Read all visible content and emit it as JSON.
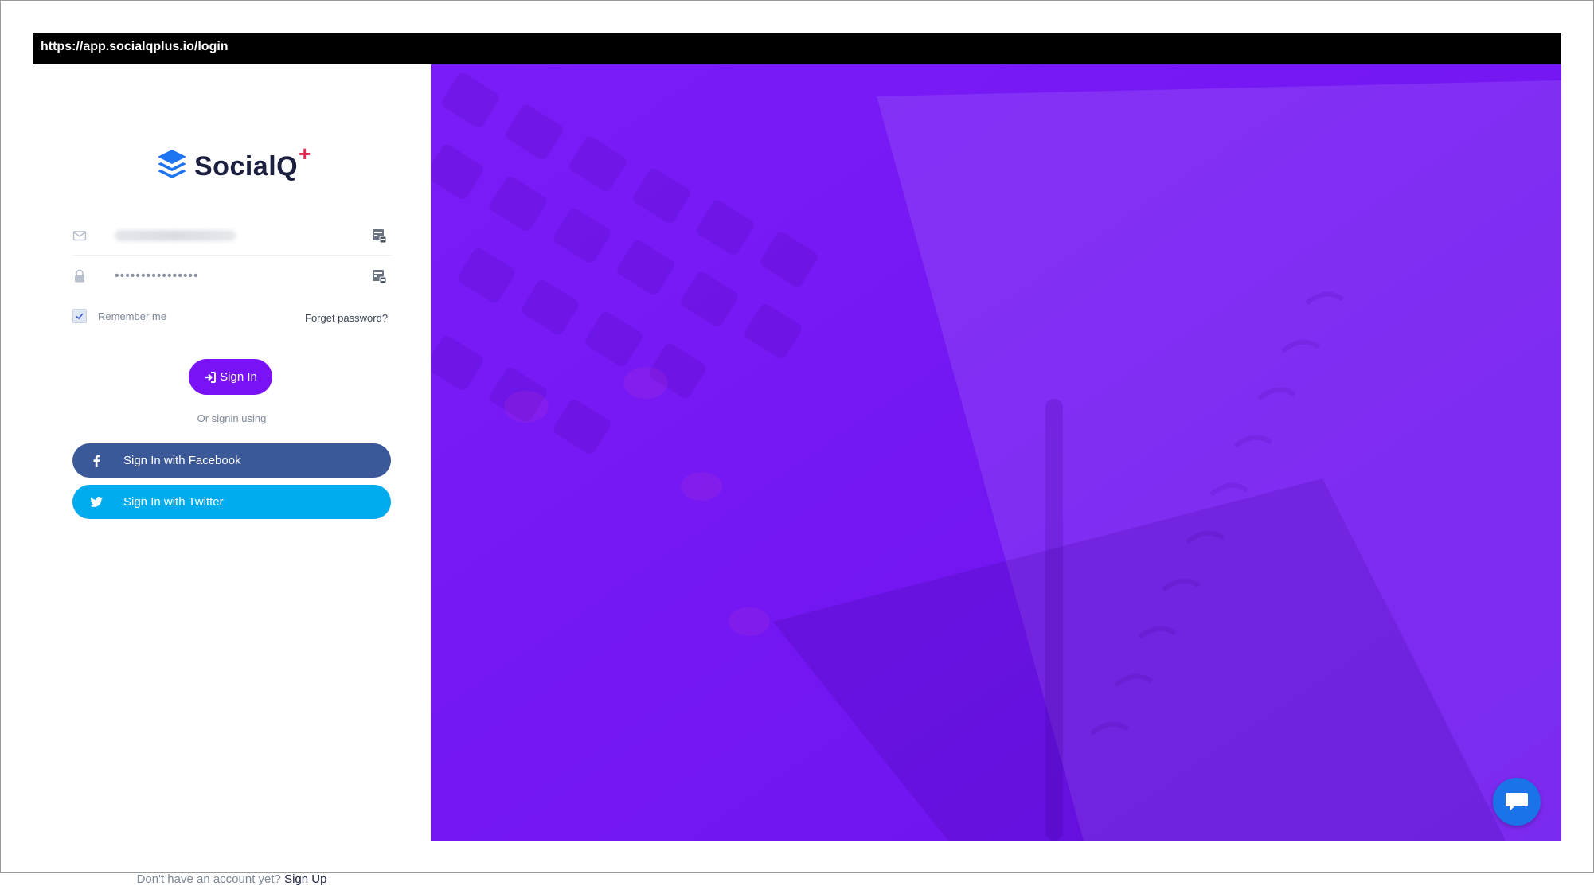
{
  "browser": {
    "url": "https://app.socialqplus.io/login"
  },
  "logo": {
    "text": "SocialQ",
    "plus": "+"
  },
  "form": {
    "email_value": "",
    "password_value": "••••••••••••••••",
    "remember_label": "Remember me",
    "remember_checked": true,
    "forgot_label": "Forget password?",
    "signin_label": "Sign In",
    "or_text": "Or signin using"
  },
  "social": {
    "facebook_label": "Sign In with Facebook",
    "twitter_label": "Sign In with Twitter"
  },
  "signup": {
    "question": "Don't have an account yet?",
    "link": "Sign Up"
  },
  "colors": {
    "accent": "#7a12f7",
    "hero": "#7a1cf7",
    "facebook": "#3b5998",
    "twitter": "#00aced",
    "chat": "#1a73e8"
  },
  "icons": {
    "logo": "layers-stack-icon",
    "email": "envelope-icon",
    "password": "lock-icon",
    "password_manager": "keypass-icon",
    "signin": "sign-in-icon",
    "facebook": "facebook-icon",
    "twitter": "twitter-icon",
    "chat": "chat-bubble-icon"
  }
}
